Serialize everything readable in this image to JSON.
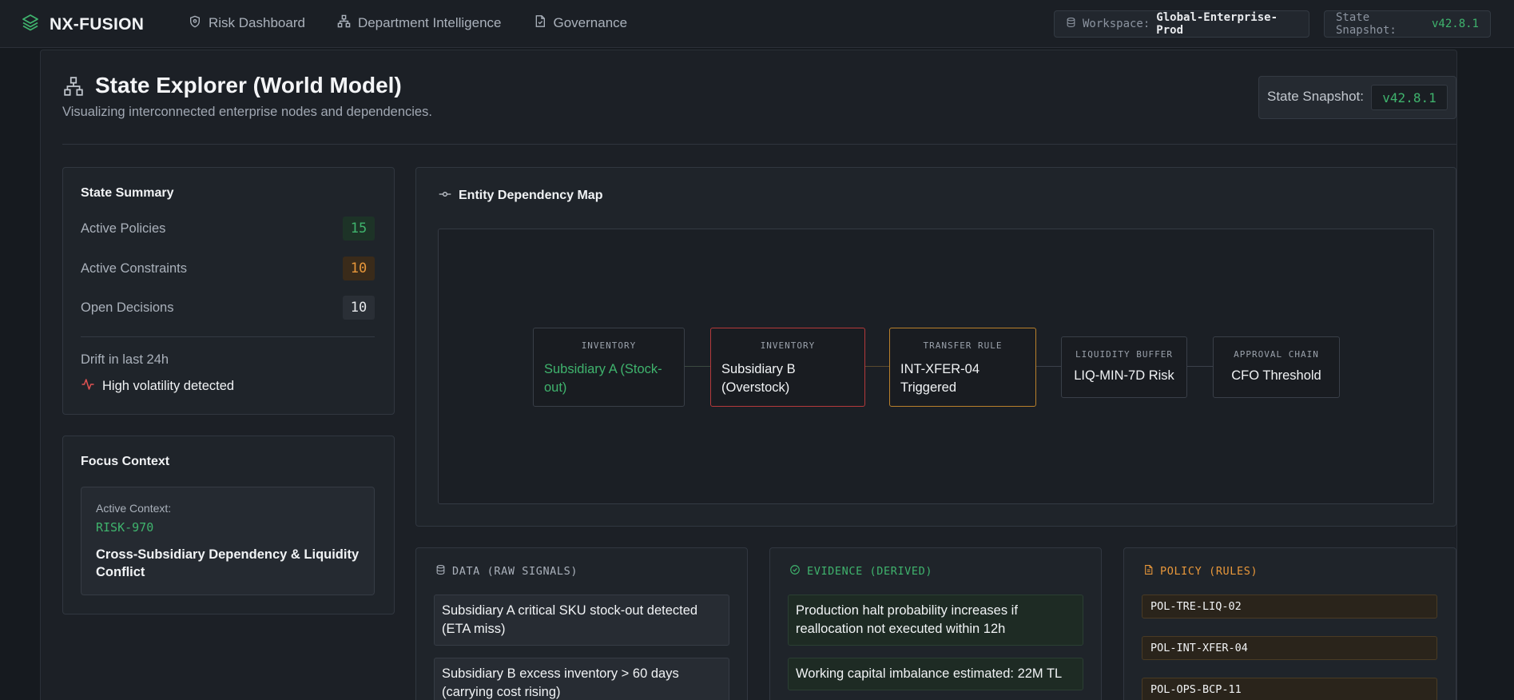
{
  "app": {
    "name": "NX-FUSION"
  },
  "nav": {
    "items": [
      {
        "label": "Risk Dashboard",
        "icon": "shield-icon"
      },
      {
        "label": "Department Intelligence",
        "icon": "org-chart-icon"
      },
      {
        "label": "Governance",
        "icon": "document-check-icon"
      }
    ]
  },
  "topbar": {
    "workspace_label": "Workspace:",
    "workspace_value": "Global-Enterprise-Prod",
    "snapshot_label": "State Snapshot:",
    "snapshot_value": "v42.8.1"
  },
  "header": {
    "title": "State Explorer (World Model)",
    "subtitle": "Visualizing interconnected enterprise nodes and dependencies.",
    "snapshot_label": "State Snapshot:",
    "snapshot_value": "v42.8.1"
  },
  "summary": {
    "title": "State Summary",
    "rows": [
      {
        "label": "Active Policies",
        "value": "15"
      },
      {
        "label": "Active Constraints",
        "value": "10"
      },
      {
        "label": "Open Decisions",
        "value": "10"
      }
    ],
    "drift_label": "Drift in last 24h",
    "drift_status": "High volatility detected"
  },
  "focus": {
    "title": "Focus Context",
    "label": "Active Context:",
    "id": "RISK-970",
    "description": "Cross-Subsidiary Dependency & Liquidity Conflict"
  },
  "map": {
    "title": "Entity Dependency Map",
    "nodes": [
      {
        "type": "INVENTORY",
        "name": "Subsidiary A (Stock-out)"
      },
      {
        "type": "INVENTORY",
        "name": "Subsidiary B (Overstock)"
      },
      {
        "type": "TRANSFER RULE",
        "name": "INT-XFER-04 Triggered"
      },
      {
        "type": "LIQUIDITY BUFFER",
        "name": "LIQ-MIN-7D Risk"
      },
      {
        "type": "APPROVAL CHAIN",
        "name": "CFO Threshold"
      }
    ]
  },
  "data_col": {
    "title": "DATA (RAW SIGNALS)",
    "items": [
      "Subsidiary A critical SKU stock-out detected (ETA miss)",
      "Subsidiary B excess inventory > 60 days (carrying cost rising)"
    ]
  },
  "evidence_col": {
    "title": "EVIDENCE (DERIVED)",
    "items": [
      "Production halt probability increases if reallocation not executed within 12h",
      "Working capital imbalance estimated: 22M TL"
    ]
  },
  "policy_col": {
    "title": "POLICY (RULES)",
    "items": [
      "POL-TRE-LIQ-02",
      "POL-INT-XFER-04",
      "POL-OPS-BCP-11"
    ]
  },
  "colors": {
    "green": "#3fb36d",
    "orange": "#e8973a",
    "red": "#e05252"
  }
}
